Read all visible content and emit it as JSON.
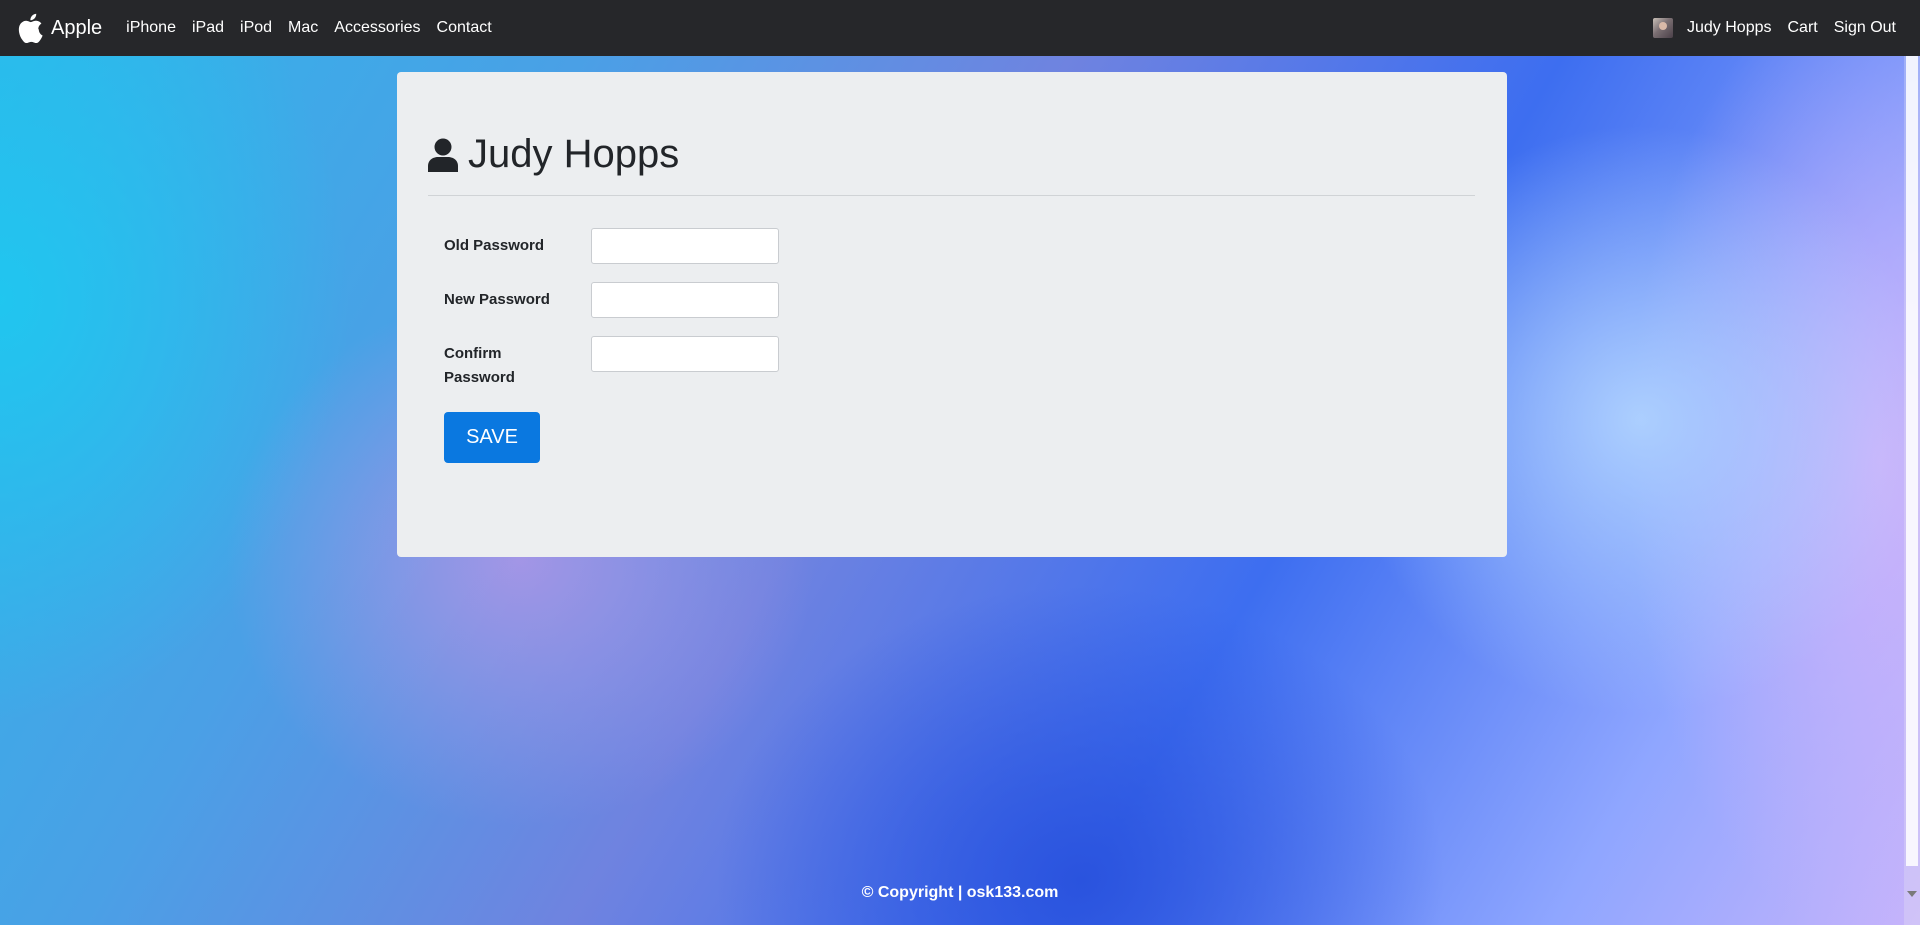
{
  "navbar": {
    "brand": "Apple",
    "links": [
      "iPhone",
      "iPad",
      "iPod",
      "Mac",
      "Accessories",
      "Contact"
    ],
    "user_name": "Judy Hopps",
    "cart": "Cart",
    "sign_out": "Sign Out"
  },
  "profile": {
    "title": "Judy Hopps"
  },
  "form": {
    "old_password_label": "Old Password",
    "new_password_label": "New Password",
    "confirm_password_label": "Confirm Password",
    "old_password_value": "",
    "new_password_value": "",
    "confirm_password_value": "",
    "save_label": "SAVE"
  },
  "footer": {
    "text": "© Copyright | osk133.com"
  },
  "icons": {
    "brand": "apple-icon",
    "title": "user-icon",
    "avatar": "user-avatar"
  },
  "colors": {
    "navbar_bg": "#26272a",
    "card_bg": "#eceef0",
    "save_button": "#0a78e0"
  }
}
